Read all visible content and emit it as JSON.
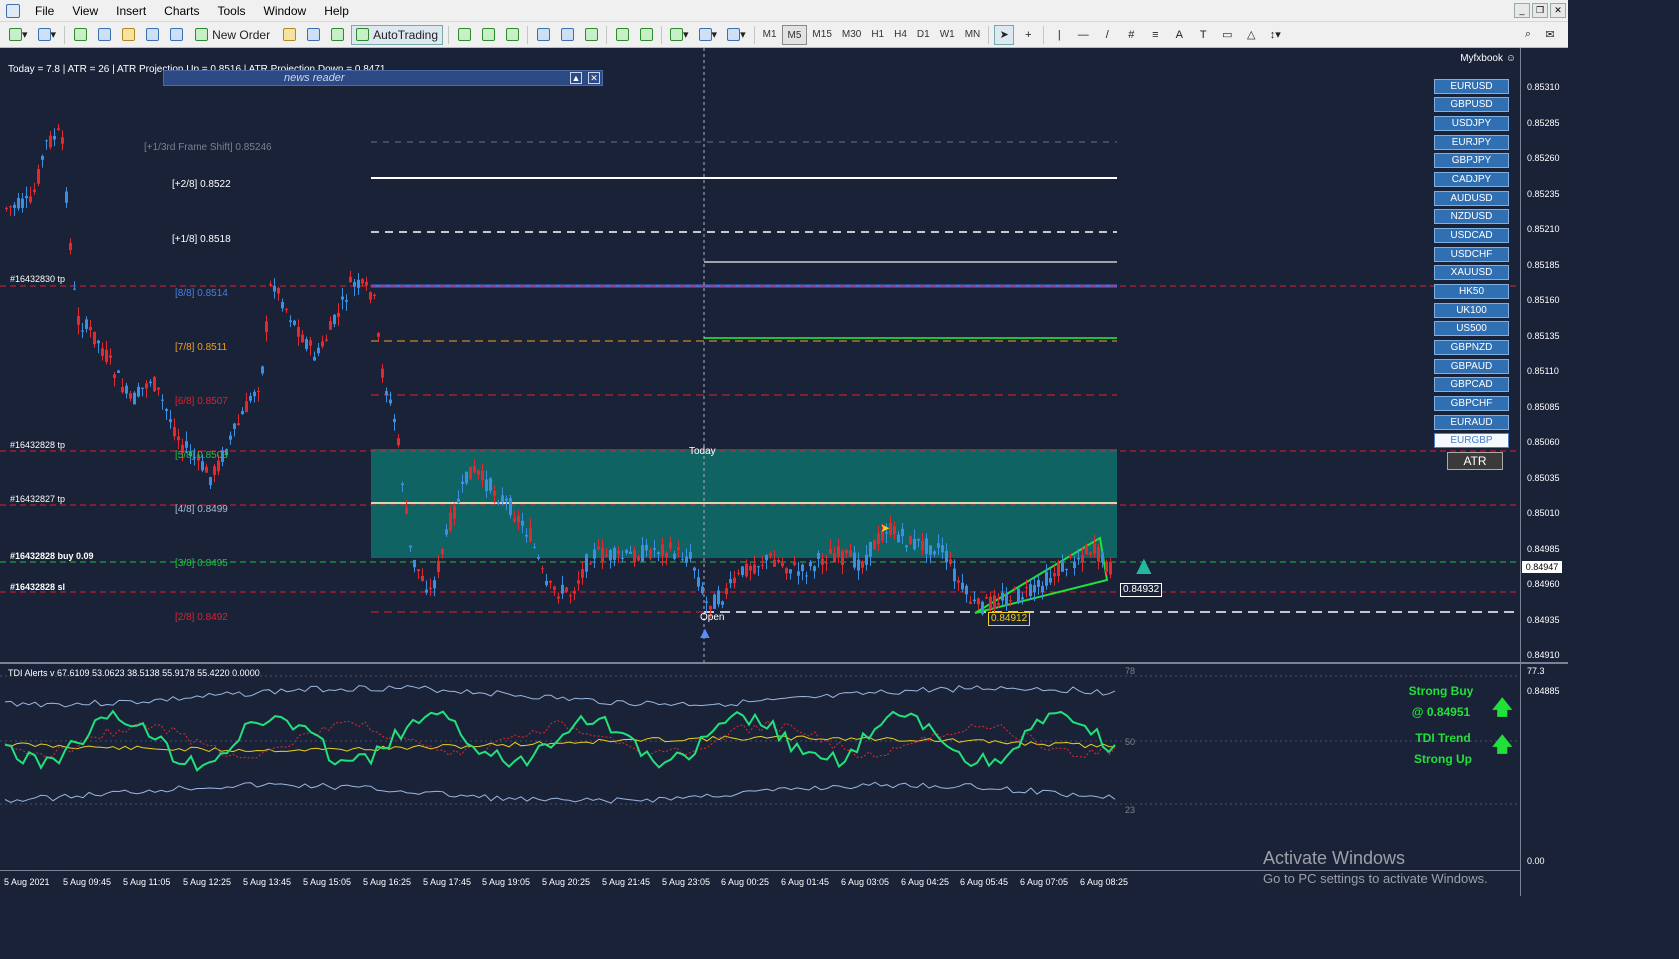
{
  "menu": [
    "File",
    "View",
    "Insert",
    "Charts",
    "Tools",
    "Window",
    "Help"
  ],
  "toolbar": {
    "new_order": "New Order",
    "autotrading": "AutoTrading",
    "timeframes": [
      "M1",
      "M5",
      "M15",
      "M30",
      "H1",
      "H4",
      "D1",
      "W1",
      "MN"
    ],
    "active_timeframe": "M5"
  },
  "chart": {
    "info_bar": "Today = 7.8   |   ATR = 26   |   ATR Projection Up = 0.8516   |   ATR Projection Down = 0.8471",
    "news_reader": "news reader",
    "myfxbook": "Myfxbook",
    "today_label": "Today",
    "open_label": "Open",
    "levels": [
      {
        "label": "[+1/3rd Frame Shift]  0.85246",
        "color": "#7a8090"
      },
      {
        "label": "[+2/8]  0.8522",
        "color": "#ffffff"
      },
      {
        "label": "[+1/8]  0.8518",
        "color": "#ffffff"
      },
      {
        "label": "[8/8]  0.8514",
        "color": "#4a7fe0"
      },
      {
        "label": "[7/8]  0.8511",
        "color": "#f0a020"
      },
      {
        "label": "[6/8]  0.8507",
        "color": "#e0202a"
      },
      {
        "label": "[5/8]  0.8503",
        "color": "#22c040"
      },
      {
        "label": "[4/8]  0.8499",
        "color": "#aab8d8"
      },
      {
        "label": "[3/8]  0.8495",
        "color": "#22c040"
      },
      {
        "label": "[2/8]  0.8492",
        "color": "#e0202a"
      }
    ],
    "orders": [
      "#16432830 tp",
      "#16432828 tp",
      "#16432827 tp",
      "#16432828 buy 0.09",
      "#16432828 sl"
    ],
    "price_tags": [
      "0.84932",
      "0.84912"
    ],
    "symbols": [
      "EURUSD",
      "GBPUSD",
      "USDJPY",
      "EURJPY",
      "GBPJPY",
      "CADJPY",
      "AUDUSD",
      "NZDUSD",
      "USDCAD",
      "USDCHF",
      "XAUUSD",
      "HK50",
      "UK100",
      "US500",
      "GBPNZD",
      "GBPAUD",
      "GBPCAD",
      "GBPCHF",
      "EURAUD",
      "EURGBP"
    ],
    "active_symbol": "EURGBP",
    "atr_button": "ATR",
    "price_axis": [
      "0.85310",
      "0.85285",
      "0.85260",
      "0.85235",
      "0.85210",
      "0.85185",
      "0.85160",
      "0.85135",
      "0.85110",
      "0.85085",
      "0.85060",
      "0.85035",
      "0.85010",
      "0.84985",
      "0.84960",
      "0.84935",
      "0.84910",
      "0.84885"
    ],
    "current_price": "0.84947",
    "time_axis": [
      "5 Aug 2021",
      "5 Aug 09:45",
      "5 Aug 11:05",
      "5 Aug 12:25",
      "5 Aug 13:45",
      "5 Aug 15:05",
      "5 Aug 16:25",
      "5 Aug 17:45",
      "5 Aug 19:05",
      "5 Aug 20:25",
      "5 Aug 21:45",
      "5 Aug 23:05",
      "6 Aug 00:25",
      "6 Aug 01:45",
      "6 Aug 03:05",
      "6 Aug 04:25",
      "6 Aug 05:45",
      "6 Aug 07:05",
      "6 Aug 08:25"
    ]
  },
  "tdi": {
    "label": "TDI Alerts v 67.6109 53.0623 38.5138 55.9178 55.4220 0.0000",
    "levels": [
      "78",
      "50",
      "23"
    ],
    "axis_top": "77.3",
    "axis_bottom": "0.00",
    "signal1_line1": "Strong Buy",
    "signal1_line2": "@ 0.84951",
    "signal2_line1": "TDI Trend",
    "signal2_line2": "Strong Up"
  },
  "watermark": {
    "line1": "Activate Windows",
    "line2": "Go to PC settings to activate Windows."
  }
}
